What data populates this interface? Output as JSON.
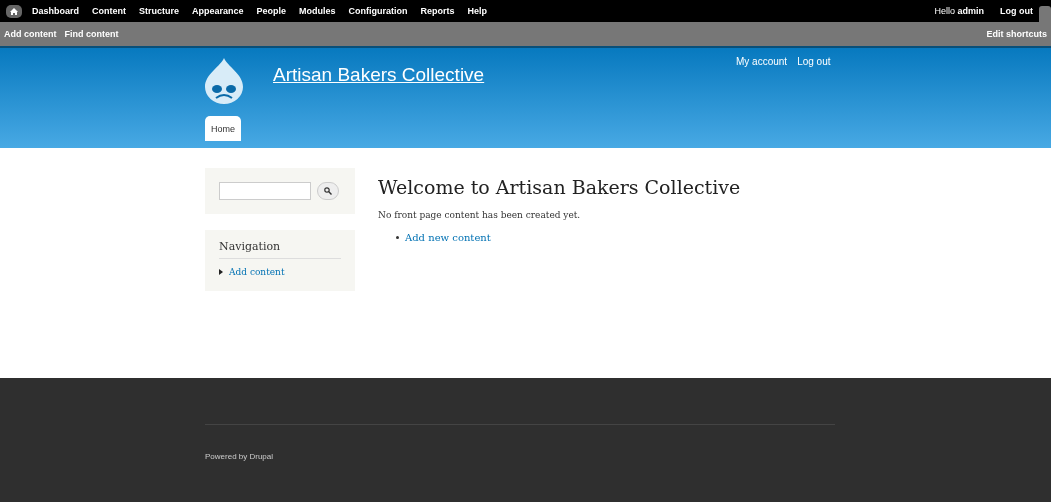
{
  "toolbar": {
    "menu": [
      "Dashboard",
      "Content",
      "Structure",
      "Appearance",
      "People",
      "Modules",
      "Configuration",
      "Reports",
      "Help"
    ],
    "greeting": "Hello **admin**",
    "logout": "Log out"
  },
  "shortcuts": {
    "items": [
      "Add content",
      "Find content"
    ],
    "edit": "Edit shortcuts"
  },
  "header": {
    "site_name": "Artisan Bakers Collective",
    "secondary_menu": [
      "My account",
      "Log out"
    ],
    "tabs": [
      {
        "label": "Home",
        "selected": true
      }
    ]
  },
  "sidebar": {
    "navigation": {
      "title": "Navigation",
      "items": [
        "Add content"
      ]
    }
  },
  "main": {
    "title": "Welcome to Artisan Bakers Collective",
    "message": "No front page content has been created yet.",
    "links": [
      "Add new content"
    ]
  },
  "footer": {
    "text": "Powered by Drupal"
  }
}
